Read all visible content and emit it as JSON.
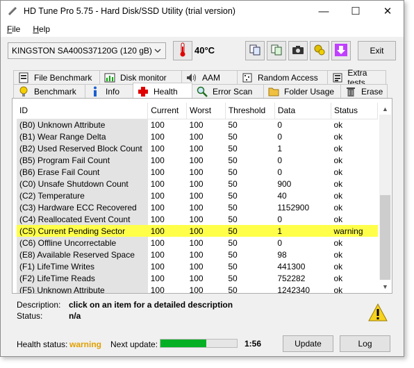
{
  "window": {
    "title": "HD Tune Pro 5.75 - Hard Disk/SSD Utility (trial version)",
    "controls": {
      "minimize": "—",
      "maximize": "☐",
      "close": "✕"
    }
  },
  "menu": {
    "file": {
      "underline": "F",
      "rest": "ile"
    },
    "help": {
      "underline": "H",
      "rest": "elp"
    }
  },
  "toolbar": {
    "drive": "KINGSTON SA400S37120G (120 gB)",
    "temperature": "40°C",
    "exit_label": "Exit"
  },
  "tabs_top": [
    "File Benchmark",
    "Disk monitor",
    "AAM",
    "Random Access",
    "Extra tests"
  ],
  "tabs_bottom": [
    "Benchmark",
    "Info",
    "Health",
    "Error Scan",
    "Folder Usage",
    "Erase"
  ],
  "active_tab": "Health",
  "table": {
    "headers": [
      "ID",
      "Current",
      "Worst",
      "Threshold",
      "Data",
      "Status"
    ],
    "rows": [
      [
        "(B0) Unknown Attribute",
        "100",
        "100",
        "50",
        "0",
        "ok"
      ],
      [
        "(B1) Wear Range Delta",
        "100",
        "100",
        "50",
        "0",
        "ok"
      ],
      [
        "(B2) Used Reserved Block Count",
        "100",
        "100",
        "50",
        "1",
        "ok"
      ],
      [
        "(B5) Program Fail Count",
        "100",
        "100",
        "50",
        "0",
        "ok"
      ],
      [
        "(B6) Erase Fail Count",
        "100",
        "100",
        "50",
        "0",
        "ok"
      ],
      [
        "(C0) Unsafe Shutdown Count",
        "100",
        "100",
        "50",
        "900",
        "ok"
      ],
      [
        "(C2) Temperature",
        "100",
        "100",
        "50",
        "40",
        "ok"
      ],
      [
        "(C3) Hardware ECC Recovered",
        "100",
        "100",
        "50",
        "1152900",
        "ok"
      ],
      [
        "(C4) Reallocated Event Count",
        "100",
        "100",
        "50",
        "0",
        "ok"
      ],
      [
        "(C5) Current Pending Sector",
        "100",
        "100",
        "50",
        "1",
        "warning"
      ],
      [
        "(C6) Offline Uncorrectable",
        "100",
        "100",
        "50",
        "0",
        "ok"
      ],
      [
        "(E8) Available Reserved Space",
        "100",
        "100",
        "50",
        "98",
        "ok"
      ],
      [
        "(F1) LifeTime Writes",
        "100",
        "100",
        "50",
        "441300",
        "ok"
      ],
      [
        "(F2) LifeTime Reads",
        "100",
        "100",
        "50",
        "752282",
        "ok"
      ],
      [
        "(F5) Unknown Attribute",
        "100",
        "100",
        "50",
        "1242340",
        "ok"
      ]
    ]
  },
  "description": {
    "label": "Description:",
    "value": "click on an item for a detailed description",
    "status_label": "Status:",
    "status_value": "n/a"
  },
  "status": {
    "health_label": "Health status:",
    "health_value": "warning",
    "next_update_label": "Next update:",
    "progress_fraction": 0.6,
    "time": "1:56",
    "update_label": "Update",
    "log_label": "Log"
  },
  "colors": {
    "warning_row": "#ffff4a",
    "warning_text": "#e0a000",
    "progress": "#06b025"
  }
}
